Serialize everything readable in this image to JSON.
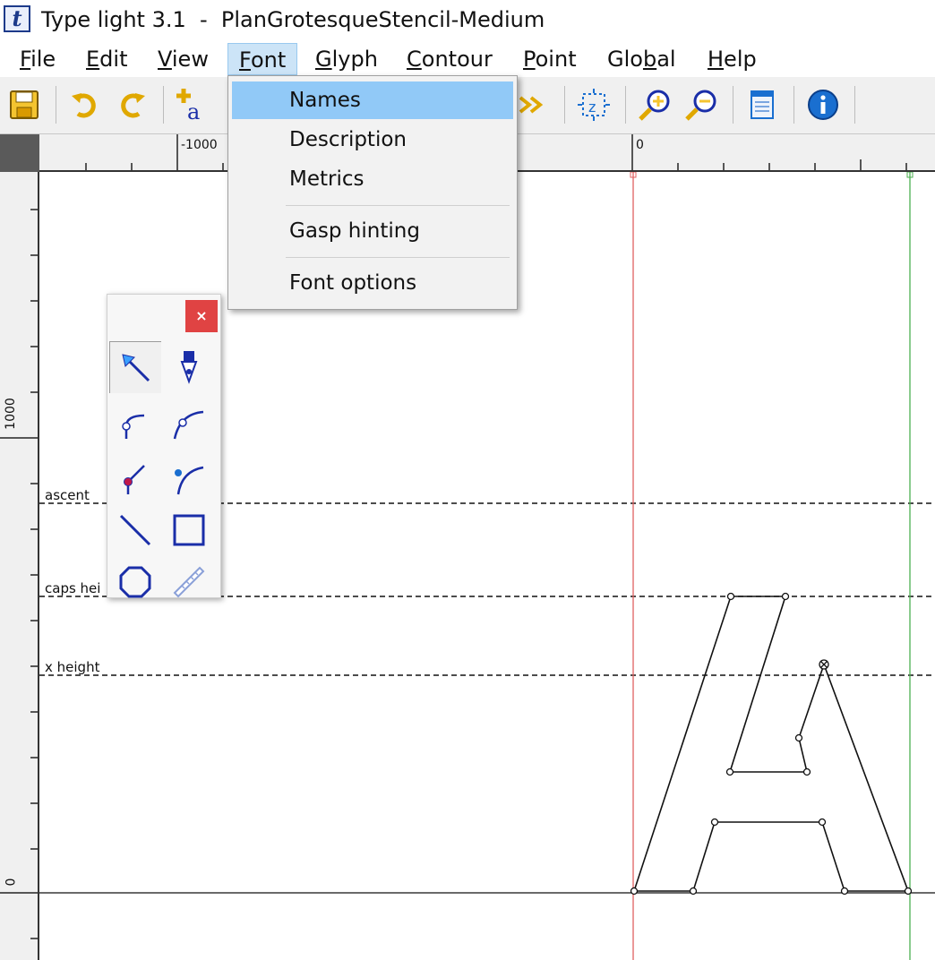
{
  "window": {
    "app_icon_letter": "t",
    "title": "Type light 3.1  -  PlanGrotesqueStencil-Medium"
  },
  "menubar": {
    "items": [
      {
        "mnemonic": "F",
        "rest": "ile"
      },
      {
        "mnemonic": "E",
        "rest": "dit"
      },
      {
        "mnemonic": "V",
        "rest": "iew"
      },
      {
        "mnemonic": "F",
        "rest": "ont"
      },
      {
        "mnemonic": "G",
        "rest": "lyph"
      },
      {
        "mnemonic": "C",
        "rest": "ontour"
      },
      {
        "mnemonic": "P",
        "rest": "oint"
      },
      {
        "prefix": "Glo",
        "mnemonic": "b",
        "rest": "al"
      },
      {
        "mnemonic": "H",
        "rest": "elp"
      }
    ],
    "active": "Font"
  },
  "toolbar": {
    "buttons": [
      "save-icon",
      "undo-icon",
      "redo-icon",
      "add-glyph-icon",
      "next-glyph-icon",
      "zoom-fit-icon",
      "zoom-in-icon",
      "zoom-out-icon",
      "window-icon",
      "info-icon"
    ]
  },
  "font_menu": {
    "items": [
      "Names",
      "Description",
      "Metrics",
      "Gasp hinting",
      "Font options"
    ],
    "selected": "Names"
  },
  "rulers": {
    "top_labels": [
      "-1000",
      "0"
    ],
    "left_labels": [
      "1000",
      "0"
    ]
  },
  "guides": {
    "ascent": "ascent",
    "caps_height": "caps hei",
    "x_height": "x height"
  },
  "tool_palette": {
    "close_label": "×",
    "tools": [
      "select-arrow-icon",
      "pen-icon",
      "corner-point-icon",
      "smooth-point-icon",
      "tangent-point-icon",
      "curve-point-icon",
      "line-icon",
      "rectangle-icon",
      "ellipse-icon",
      "ruler-icon"
    ],
    "active_tool": "select-arrow-icon"
  },
  "colors": {
    "menu_highlight": "#91c9f7",
    "menu_active_bg": "#cce4f7",
    "left_sidebearing": "#e06060",
    "advance_width": "#4caf50",
    "close_button": "#e04343",
    "tool_blue": "#1a2ea8"
  }
}
